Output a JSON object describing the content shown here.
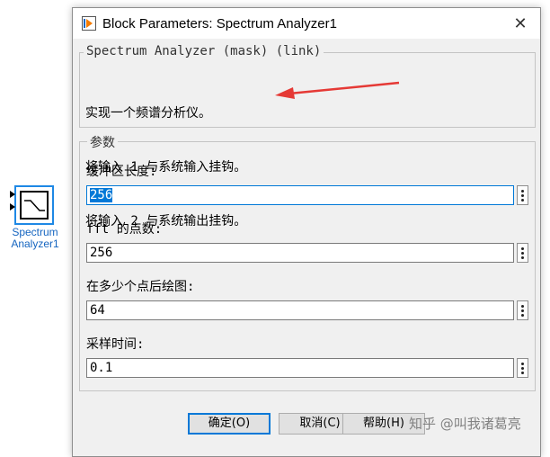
{
  "block": {
    "label_line1": "Spectrum",
    "label_line2": "Analyzer1",
    "accent_color": "#1e88e5"
  },
  "dialog": {
    "title": "Block Parameters: Spectrum Analyzer1",
    "title_icon": "simulink-block-icon",
    "close_icon": "close-icon",
    "mask_legend": "Spectrum Analyzer (mask) (link)",
    "description": [
      "实现一个频谱分析仪。",
      "将输入 1 与系统输入挂钩。",
      "将输入 2 与系统输出挂钩。"
    ],
    "params_legend": "参数",
    "params": [
      {
        "label": "缓冲区长度:",
        "value": "256"
      },
      {
        "label": "fft 的点数:",
        "value": "256"
      },
      {
        "label": "在多少个点后绘图:",
        "value": "64"
      },
      {
        "label": "采样时间:",
        "value": "0.1"
      }
    ],
    "buttons": {
      "ok": "确定(O)",
      "cancel": "取消(C)",
      "help": "帮助(H)"
    }
  },
  "watermark": "知乎 @叫我诸葛亮",
  "annotation_arrow_color": "#e53935"
}
